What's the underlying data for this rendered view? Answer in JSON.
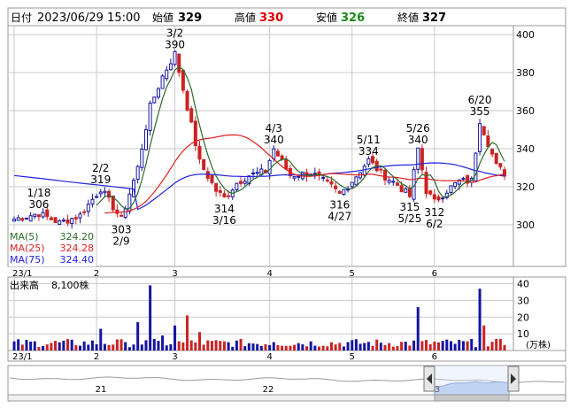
{
  "header": {
    "date_label": "日付",
    "datetime": "2023/06/29 15:00",
    "open_label": "始値",
    "open_value": "329",
    "high_label": "高値",
    "high_value": "330",
    "low_label": "安値",
    "low_value": "326",
    "close_label": "終値",
    "close_value": "327"
  },
  "colors": {
    "up": "#1515a0",
    "down": "#cc2222",
    "ma5": "#2b6b2b",
    "ma25": "#e02020",
    "ma75": "#2222dd",
    "high": "#e00000",
    "low": "#1a8a1a",
    "grid": "#c8c8c8"
  },
  "chart_data": [
    {
      "type": "candlestick",
      "y_ticks": [
        "400",
        "380",
        "360",
        "340",
        "320",
        "300"
      ],
      "ylim": [
        290,
        402
      ],
      "x_ticks": [
        "23/1",
        "2",
        "3",
        "4",
        "5",
        "6"
      ],
      "legend": [
        {
          "key": "ma5",
          "label": "MA(5)",
          "value": "324.20"
        },
        {
          "key": "ma25",
          "label": "MA(25)",
          "value": "324.28"
        },
        {
          "key": "ma75",
          "label": "MA(75)",
          "value": "324.40"
        }
      ],
      "annotations": [
        {
          "date": "1/18",
          "value": "306"
        },
        {
          "date": "2/2",
          "value": "319"
        },
        {
          "date": "2/9",
          "value": "303"
        },
        {
          "date": "3/2",
          "value": "390"
        },
        {
          "date": "3/16",
          "value": "314"
        },
        {
          "date": "4/3",
          "value": "340"
        },
        {
          "date": "4/27",
          "value": "316"
        },
        {
          "date": "5/11",
          "value": "334"
        },
        {
          "date": "5/25",
          "value": "315"
        },
        {
          "date": "5/26",
          "value": "340"
        },
        {
          "date": "6/2",
          "value": "312"
        },
        {
          "date": "6/20",
          "value": "355"
        }
      ]
    },
    {
      "type": "bar",
      "title": "出来高",
      "last_volume": "8,100株",
      "y_ticks": [
        "40",
        "30",
        "20",
        "10"
      ],
      "unit": "(万株)",
      "ylim": [
        0,
        44
      ],
      "x_ticks": [
        "23/1",
        "2",
        "3",
        "4",
        "5",
        "6"
      ]
    },
    {
      "type": "area",
      "labels": [
        "21",
        "22",
        "3"
      ]
    }
  ]
}
